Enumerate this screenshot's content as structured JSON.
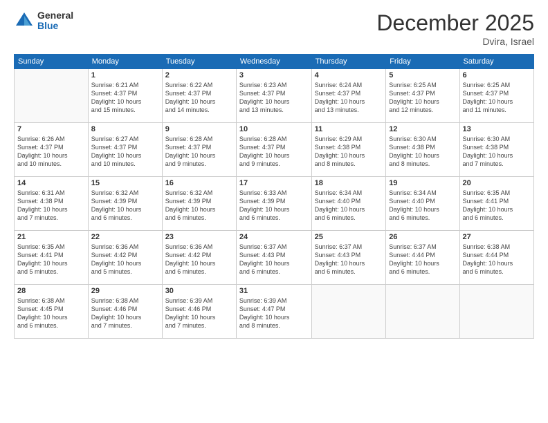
{
  "logo": {
    "general": "General",
    "blue": "Blue"
  },
  "header": {
    "month": "December 2025",
    "location": "Dvira, Israel"
  },
  "weekdays": [
    "Sunday",
    "Monday",
    "Tuesday",
    "Wednesday",
    "Thursday",
    "Friday",
    "Saturday"
  ],
  "weeks": [
    [
      {
        "day": null,
        "info": null
      },
      {
        "day": "1",
        "info": "Sunrise: 6:21 AM\nSunset: 4:37 PM\nDaylight: 10 hours\nand 15 minutes."
      },
      {
        "day": "2",
        "info": "Sunrise: 6:22 AM\nSunset: 4:37 PM\nDaylight: 10 hours\nand 14 minutes."
      },
      {
        "day": "3",
        "info": "Sunrise: 6:23 AM\nSunset: 4:37 PM\nDaylight: 10 hours\nand 13 minutes."
      },
      {
        "day": "4",
        "info": "Sunrise: 6:24 AM\nSunset: 4:37 PM\nDaylight: 10 hours\nand 13 minutes."
      },
      {
        "day": "5",
        "info": "Sunrise: 6:25 AM\nSunset: 4:37 PM\nDaylight: 10 hours\nand 12 minutes."
      },
      {
        "day": "6",
        "info": "Sunrise: 6:25 AM\nSunset: 4:37 PM\nDaylight: 10 hours\nand 11 minutes."
      }
    ],
    [
      {
        "day": "7",
        "info": "Sunrise: 6:26 AM\nSunset: 4:37 PM\nDaylight: 10 hours\nand 10 minutes."
      },
      {
        "day": "8",
        "info": "Sunrise: 6:27 AM\nSunset: 4:37 PM\nDaylight: 10 hours\nand 10 minutes."
      },
      {
        "day": "9",
        "info": "Sunrise: 6:28 AM\nSunset: 4:37 PM\nDaylight: 10 hours\nand 9 minutes."
      },
      {
        "day": "10",
        "info": "Sunrise: 6:28 AM\nSunset: 4:37 PM\nDaylight: 10 hours\nand 9 minutes."
      },
      {
        "day": "11",
        "info": "Sunrise: 6:29 AM\nSunset: 4:38 PM\nDaylight: 10 hours\nand 8 minutes."
      },
      {
        "day": "12",
        "info": "Sunrise: 6:30 AM\nSunset: 4:38 PM\nDaylight: 10 hours\nand 8 minutes."
      },
      {
        "day": "13",
        "info": "Sunrise: 6:30 AM\nSunset: 4:38 PM\nDaylight: 10 hours\nand 7 minutes."
      }
    ],
    [
      {
        "day": "14",
        "info": "Sunrise: 6:31 AM\nSunset: 4:38 PM\nDaylight: 10 hours\nand 7 minutes."
      },
      {
        "day": "15",
        "info": "Sunrise: 6:32 AM\nSunset: 4:39 PM\nDaylight: 10 hours\nand 6 minutes."
      },
      {
        "day": "16",
        "info": "Sunrise: 6:32 AM\nSunset: 4:39 PM\nDaylight: 10 hours\nand 6 minutes."
      },
      {
        "day": "17",
        "info": "Sunrise: 6:33 AM\nSunset: 4:39 PM\nDaylight: 10 hours\nand 6 minutes."
      },
      {
        "day": "18",
        "info": "Sunrise: 6:34 AM\nSunset: 4:40 PM\nDaylight: 10 hours\nand 6 minutes."
      },
      {
        "day": "19",
        "info": "Sunrise: 6:34 AM\nSunset: 4:40 PM\nDaylight: 10 hours\nand 6 minutes."
      },
      {
        "day": "20",
        "info": "Sunrise: 6:35 AM\nSunset: 4:41 PM\nDaylight: 10 hours\nand 6 minutes."
      }
    ],
    [
      {
        "day": "21",
        "info": "Sunrise: 6:35 AM\nSunset: 4:41 PM\nDaylight: 10 hours\nand 5 minutes."
      },
      {
        "day": "22",
        "info": "Sunrise: 6:36 AM\nSunset: 4:42 PM\nDaylight: 10 hours\nand 5 minutes."
      },
      {
        "day": "23",
        "info": "Sunrise: 6:36 AM\nSunset: 4:42 PM\nDaylight: 10 hours\nand 6 minutes."
      },
      {
        "day": "24",
        "info": "Sunrise: 6:37 AM\nSunset: 4:43 PM\nDaylight: 10 hours\nand 6 minutes."
      },
      {
        "day": "25",
        "info": "Sunrise: 6:37 AM\nSunset: 4:43 PM\nDaylight: 10 hours\nand 6 minutes."
      },
      {
        "day": "26",
        "info": "Sunrise: 6:37 AM\nSunset: 4:44 PM\nDaylight: 10 hours\nand 6 minutes."
      },
      {
        "day": "27",
        "info": "Sunrise: 6:38 AM\nSunset: 4:44 PM\nDaylight: 10 hours\nand 6 minutes."
      }
    ],
    [
      {
        "day": "28",
        "info": "Sunrise: 6:38 AM\nSunset: 4:45 PM\nDaylight: 10 hours\nand 6 minutes."
      },
      {
        "day": "29",
        "info": "Sunrise: 6:38 AM\nSunset: 4:46 PM\nDaylight: 10 hours\nand 7 minutes."
      },
      {
        "day": "30",
        "info": "Sunrise: 6:39 AM\nSunset: 4:46 PM\nDaylight: 10 hours\nand 7 minutes."
      },
      {
        "day": "31",
        "info": "Sunrise: 6:39 AM\nSunset: 4:47 PM\nDaylight: 10 hours\nand 8 minutes."
      },
      {
        "day": null,
        "info": null
      },
      {
        "day": null,
        "info": null
      },
      {
        "day": null,
        "info": null
      }
    ]
  ]
}
